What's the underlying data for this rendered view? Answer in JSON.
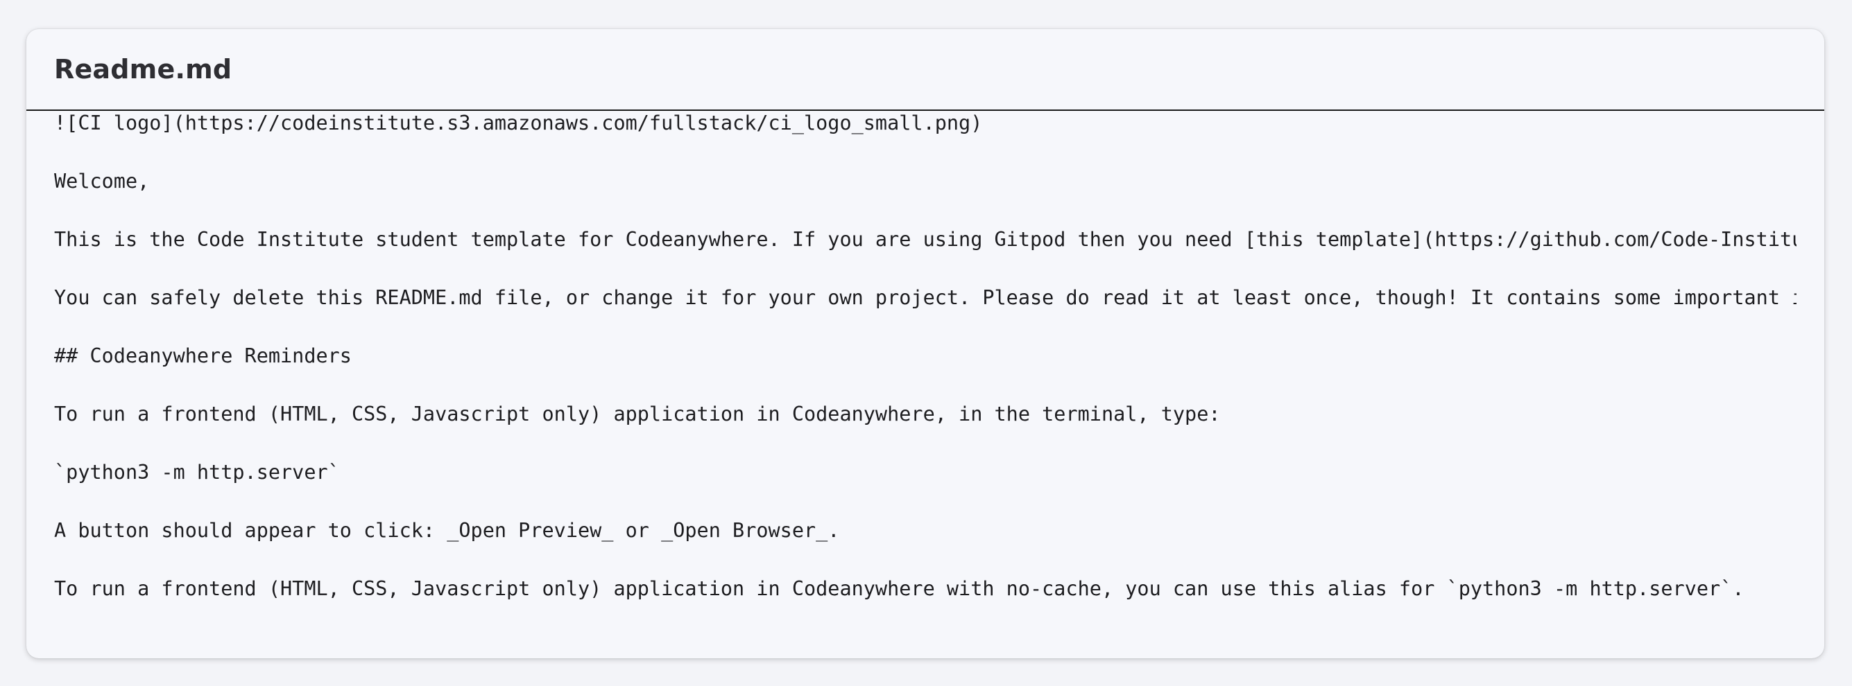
{
  "card": {
    "title": "Readme.md"
  },
  "readme": {
    "lines": [
      "![CI logo](https://codeinstitute.s3.amazonaws.com/fullstack/ci_logo_small.png)",
      "Welcome,",
      "This is the Code Institute student template for Codeanywhere. If you are using Gitpod then you need [this template](https://github.com/Code-Institute",
      "You can safely delete this README.md file, or change it for your own project. Please do read it at least once, though! It contains some important inf",
      "## Codeanywhere Reminders",
      "To run a frontend (HTML, CSS, Javascript only) application in Codeanywhere, in the terminal, type:",
      "`python3 -m http.server`",
      "A button should appear to click: _Open Preview_ or _Open Browser_.",
      "To run a frontend (HTML, CSS, Javascript only) application in Codeanywhere with no-cache, you can use this alias for `python3 -m http.server`."
    ]
  }
}
